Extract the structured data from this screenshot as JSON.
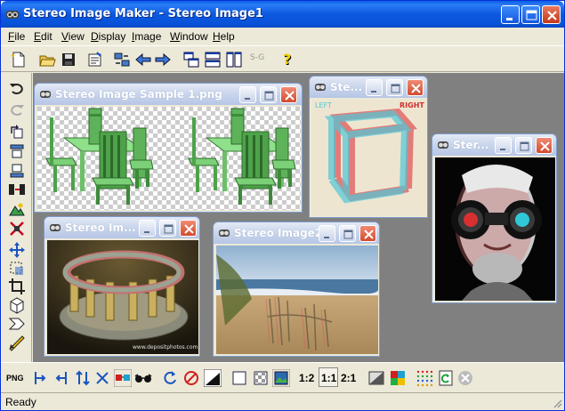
{
  "app": {
    "title": "Stereo Image Maker - Stereo Image1"
  },
  "menu": [
    {
      "label": "File",
      "key": "F"
    },
    {
      "label": "Edit",
      "key": "E"
    },
    {
      "label": "View",
      "key": "V"
    },
    {
      "label": "Display",
      "key": "D"
    },
    {
      "label": "Image",
      "key": "I"
    },
    {
      "label": "Window",
      "key": "W"
    },
    {
      "label": "Help",
      "key": "H"
    }
  ],
  "windows": {
    "sample": {
      "title": "Stereo Image Sample 1.png"
    },
    "cube": {
      "title": "Ste...",
      "left_label": "LEFT",
      "right_label": "RIGHT"
    },
    "face": {
      "title": "Ster..."
    },
    "ring": {
      "title": "Stereo Im...",
      "watermark": "www.depositphotos.com"
    },
    "beach": {
      "title": "Stereo Image2"
    }
  },
  "bottom_toolbar": {
    "png_label": "PNG",
    "zoom_half": "1:2",
    "zoom_one": "1:1",
    "zoom_double": "2:1",
    "sg_label": "S-G"
  },
  "status": {
    "text": "Ready"
  },
  "colors": {
    "titlebar": "#0A5FE6",
    "close": "#D24B2E",
    "mdi_bg": "#808080",
    "face": "#ECE9D8"
  }
}
